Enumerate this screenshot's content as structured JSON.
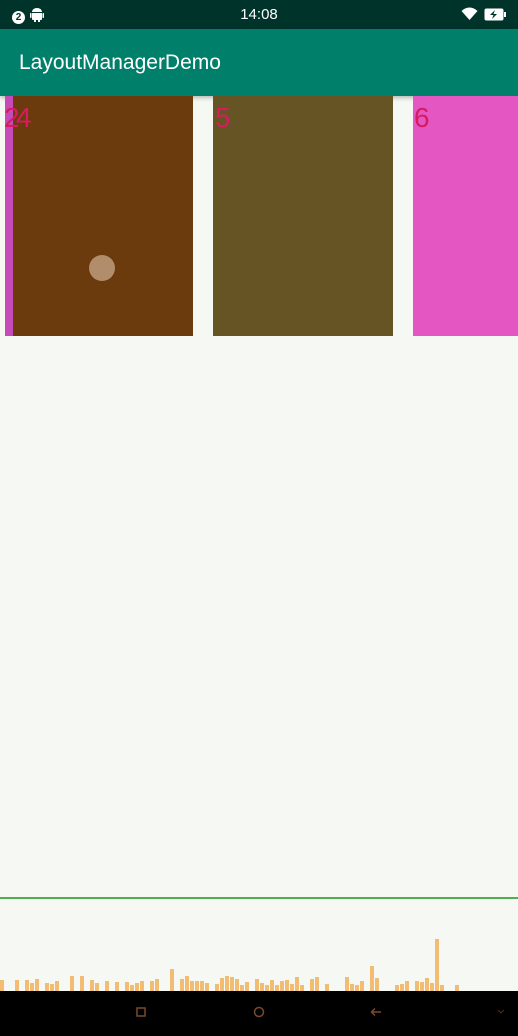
{
  "status_bar": {
    "notification_count": "2",
    "time": "14:08",
    "icons": [
      "notification-count-badge",
      "android-icon",
      "wifi-icon",
      "battery-charging-icon"
    ]
  },
  "app_bar": {
    "title": "LayoutManagerDemo"
  },
  "cards": [
    {
      "label": "4",
      "partial_label_left": "2",
      "color": "#6b3a0d"
    },
    {
      "label": "5",
      "color": "#665424"
    },
    {
      "label": "6",
      "color": "#e457c2"
    }
  ],
  "partial_card_left_color": "#c64bb8",
  "nav_bar": {
    "icons": [
      "recents-square-icon",
      "home-circle-icon",
      "back-arrow-icon",
      "collapse-chevron-icon"
    ]
  },
  "colors": {
    "status_bar": "#00332a",
    "app_bar": "#00806a",
    "background": "#f5f8f3",
    "card_number": "#d81b60",
    "gpu_threshold": "#4caf50",
    "gpu_bar": "#f2a848"
  }
}
